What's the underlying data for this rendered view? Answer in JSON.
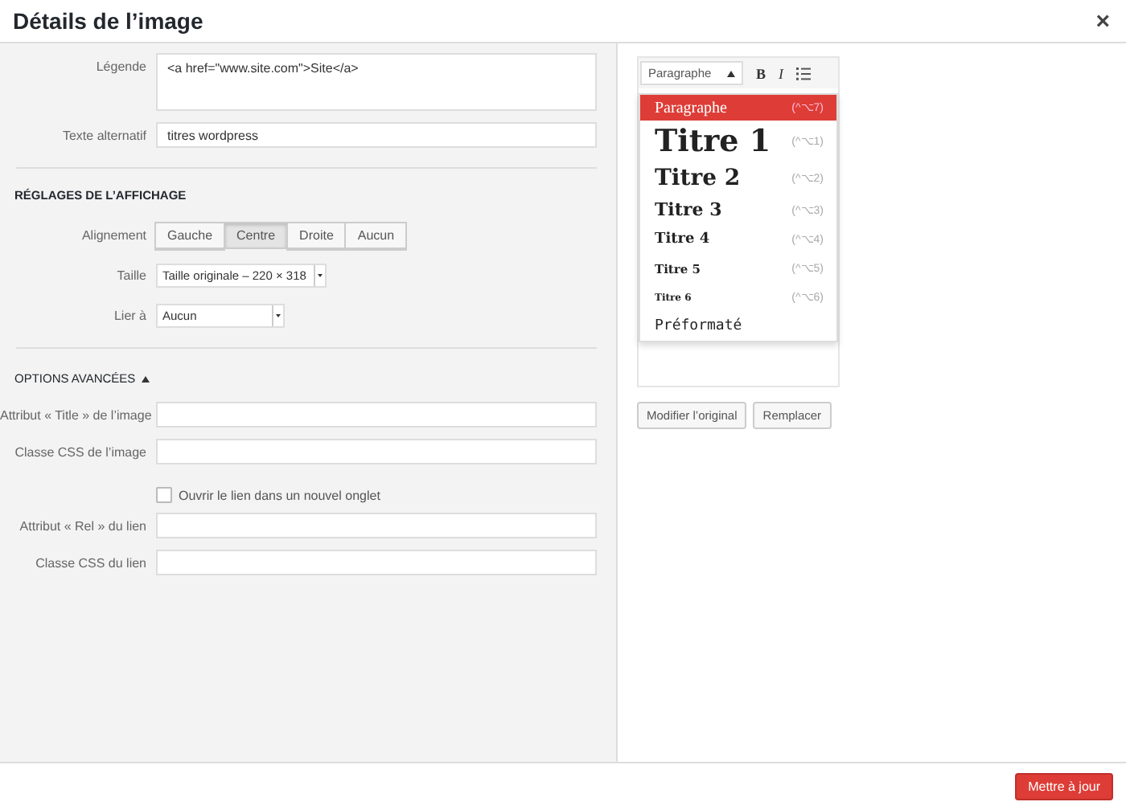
{
  "window": {
    "title": "Détails de l’image",
    "close": "×"
  },
  "fields": [
    {
      "label": "Légende",
      "kind": "textarea",
      "value": "<a href=\"www.site.com\">Site</a>"
    },
    {
      "label": "Texte alternatif",
      "kind": "text",
      "value": "titres wordpress"
    }
  ],
  "display_settings": {
    "heading": "RÉGLAGES DE L’AFFICHAGE",
    "alignment": {
      "label": "Alignement",
      "options": [
        {
          "label": "Gauche",
          "selected": false
        },
        {
          "label": "Centre",
          "selected": true
        },
        {
          "label": "Droite",
          "selected": false
        },
        {
          "label": "Aucun",
          "selected": false
        }
      ]
    },
    "size": {
      "label": "Taille",
      "value": "Taille originale – 220 × 318"
    },
    "link_to": {
      "label": "Lier à",
      "value": "Aucun"
    }
  },
  "advanced": {
    "heading": "OPTIONS AVANCÉES",
    "expanded": true,
    "fields_before": [
      {
        "label": "Attribut « Title » de l’image"
      },
      {
        "label": "Classe CSS de l’image"
      }
    ],
    "new_tab": {
      "label": "Ouvrir le lien dans un nouvel onglet",
      "checked": false
    },
    "fields_after": [
      {
        "label": "Attribut « Rel » du lien"
      },
      {
        "label": "Classe CSS du lien"
      }
    ]
  },
  "editor": {
    "format_select": {
      "value": "Paragraphe",
      "open": true
    },
    "bold": "B",
    "italic": "I",
    "format_menu": [
      {
        "kind": "p",
        "label": "Paragraphe",
        "shortcut": "(^⌥7)",
        "selected": true
      },
      {
        "kind": "h1",
        "label": "Titre 1",
        "shortcut": "(^⌥1)",
        "selected": false
      },
      {
        "kind": "h2",
        "label": "Titre 2",
        "shortcut": "(^⌥2)",
        "selected": false
      },
      {
        "kind": "h3",
        "label": "Titre 3",
        "shortcut": "(^⌥3)",
        "selected": false
      },
      {
        "kind": "h4",
        "label": "Titre 4",
        "shortcut": "(^⌥4)",
        "selected": false
      },
      {
        "kind": "h5",
        "label": "Titre 5",
        "shortcut": "(^⌥5)",
        "selected": false
      },
      {
        "kind": "h6",
        "label": "Titre 6",
        "shortcut": "(^⌥6)",
        "selected": false
      },
      {
        "kind": "pre",
        "label": "Préformaté",
        "selected": false
      }
    ]
  },
  "image_buttons": [
    "Modifier l’original",
    "Remplacer"
  ],
  "footer": {
    "button": "Mettre à jour"
  }
}
